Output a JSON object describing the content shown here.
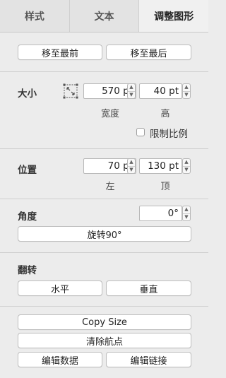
{
  "tabs": [
    "样式",
    "文本",
    "调整图形"
  ],
  "arrange": {
    "move_front": "移至最前",
    "move_back": "移至最后"
  },
  "size": {
    "label": "大小",
    "width_value": "570 pt",
    "height_value": "40 pt",
    "width_label": "宽度",
    "height_label": "高",
    "lock_ratio_label": "限制比例"
  },
  "position": {
    "label": "位置",
    "left_value": "70 pt",
    "top_value": "130 pt",
    "left_label": "左",
    "top_label": "顶"
  },
  "angle": {
    "label": "角度",
    "value": "0°",
    "rotate_button": "旋转90°"
  },
  "flip": {
    "label": "翻转",
    "horizontal": "水平",
    "vertical": "垂直"
  },
  "actions": {
    "copy_size": "Copy Size",
    "clear_waypoints": "清除航点",
    "edit_data": "编辑数据",
    "edit_link": "编辑链接"
  },
  "icons": {
    "resize": "resize-icon",
    "stepper_up": "chevron-up-icon",
    "stepper_down": "chevron-down-icon"
  }
}
